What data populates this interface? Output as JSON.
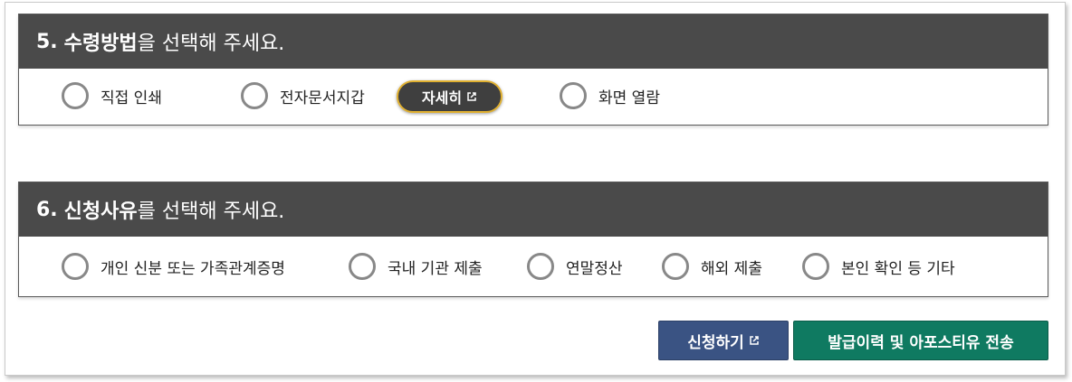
{
  "section5": {
    "number": "5.",
    "keyword": "수령방법",
    "rest": "을 선택해 주세요.",
    "options": [
      {
        "label": "직접 인쇄"
      },
      {
        "label": "전자문서지갑"
      },
      {
        "label": "화면 열람"
      }
    ],
    "detail_button": "자세히"
  },
  "section6": {
    "number": "6.",
    "keyword": "신청사유",
    "rest": "를 선택해 주세요.",
    "options": [
      {
        "label": "개인 신분 또는 가족관계증명"
      },
      {
        "label": "국내 기관 제출"
      },
      {
        "label": "연말정산"
      },
      {
        "label": "해외 제출"
      },
      {
        "label": "본인 확인 등 기타"
      }
    ]
  },
  "actions": {
    "apply_label": "신청하기",
    "history_label": "발급이력 및 아포스티유 전송"
  },
  "colors": {
    "header_bg": "#4a4a4a",
    "apply_bg": "#3a5383",
    "history_bg": "#0f7a61",
    "detail_border": "#e0b030"
  }
}
